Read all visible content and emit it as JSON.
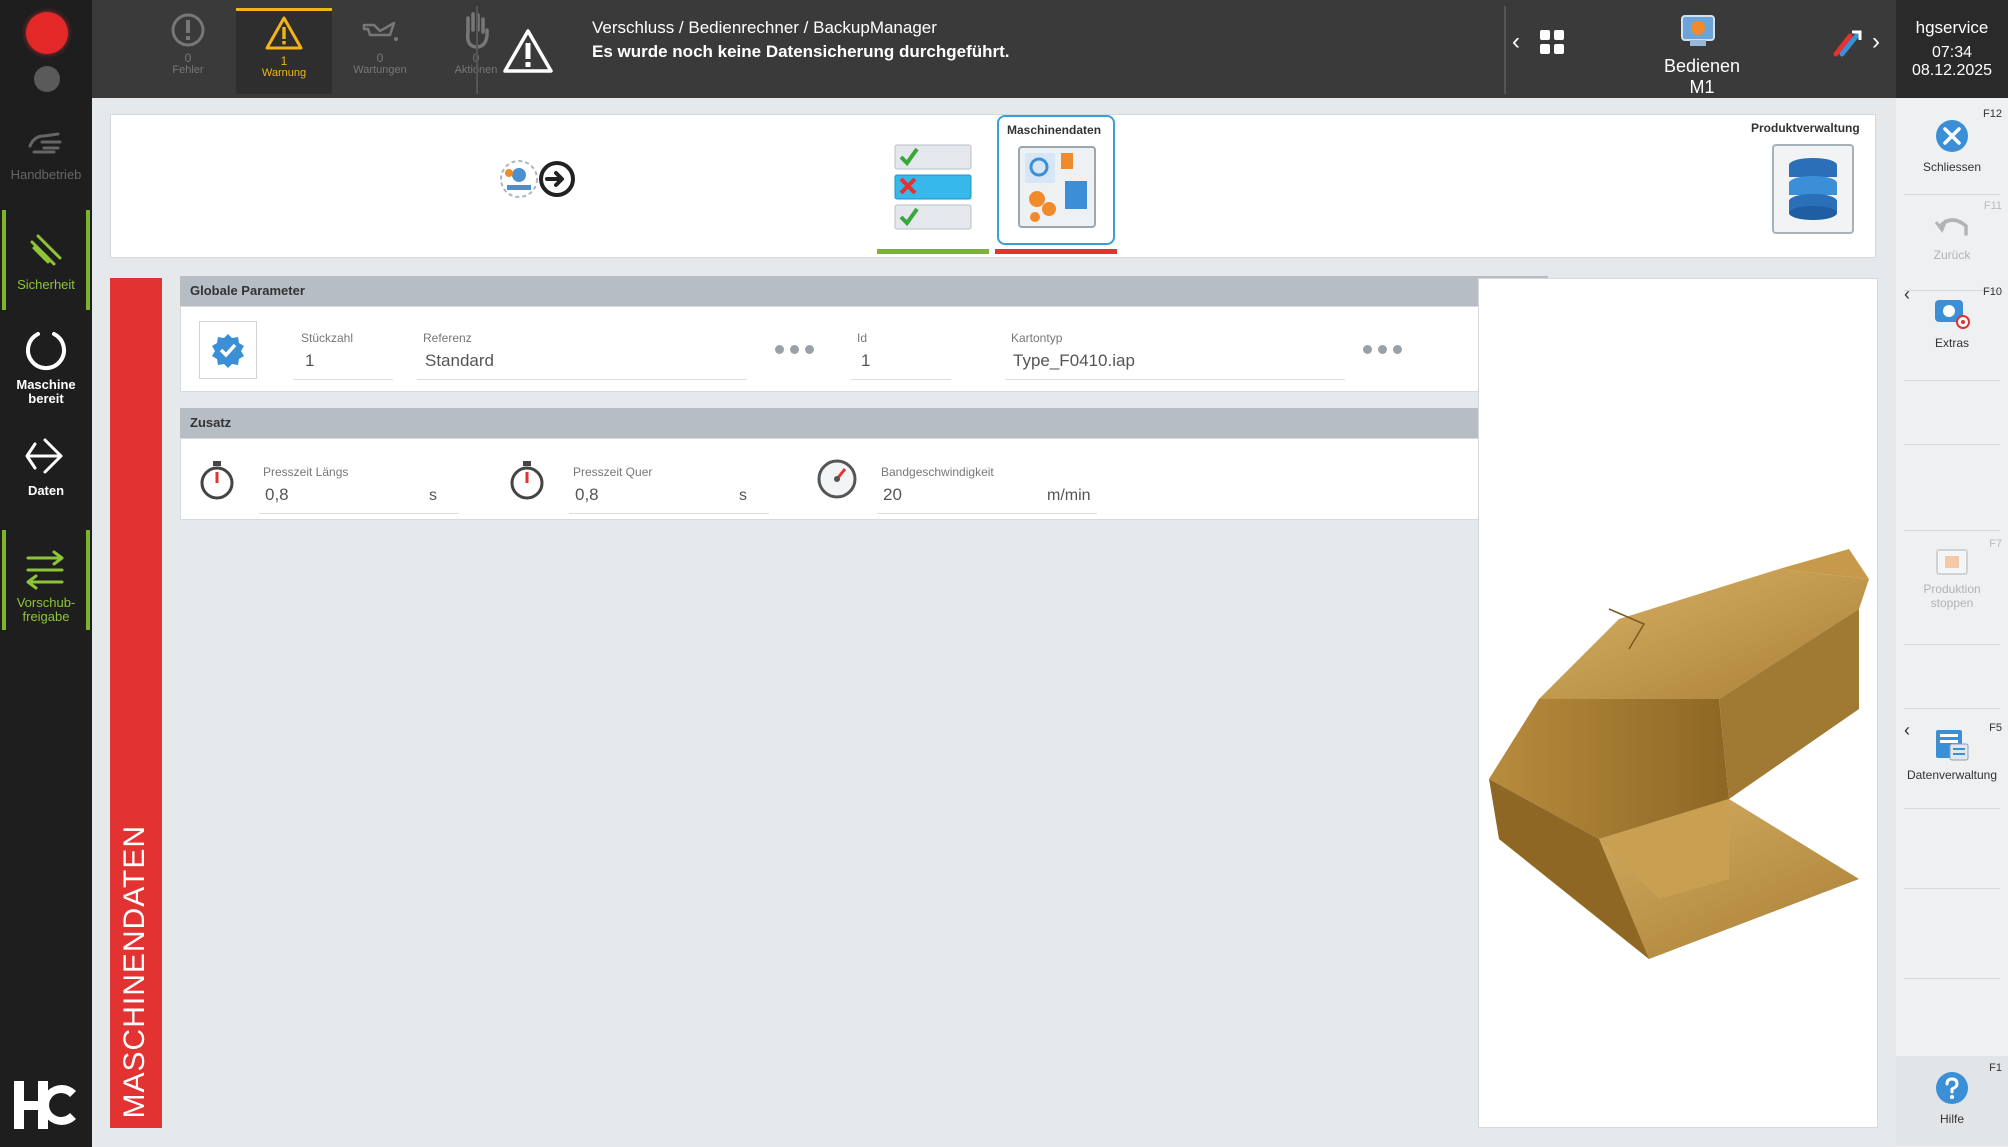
{
  "sidebar": {
    "items": [
      {
        "label": "Handbetrieb",
        "state": "disabled"
      },
      {
        "label": "Sicherheit",
        "state": "active"
      },
      {
        "label": "Maschine bereit",
        "state": "normal"
      },
      {
        "label": "Daten",
        "state": "normal"
      },
      {
        "label": "Vorschub-freigabe",
        "state": "active"
      }
    ],
    "logo": "HC"
  },
  "topbar": {
    "tabs": [
      {
        "count": "0",
        "label": "Fehler",
        "icon": "error-icon",
        "active": false
      },
      {
        "count": "1",
        "label": "Warnung",
        "icon": "warning-icon",
        "active": true
      },
      {
        "count": "0",
        "label": "Wartungen",
        "icon": "oilcan-icon",
        "active": false
      },
      {
        "count": "0",
        "label": "Aktionen",
        "icon": "hand-icon",
        "active": false
      }
    ],
    "message": {
      "title": "Verschluss / Bedienrechner / BackupManager",
      "text": "Es wurde noch keine Datensicherung durchgeführt."
    },
    "machine_label": "Bedienen M1",
    "user": "hgservice",
    "time": "07:34",
    "date": "08.12.2025"
  },
  "nav": {
    "machine_data_label": "Maschinendaten",
    "product_mgmt_label": "Produktverwaltung"
  },
  "side_title": "MASCHINENDATEN",
  "global_params": {
    "header": "Globale Parameter",
    "stueckzahl_label": "Stückzahl",
    "stueckzahl_value": "1",
    "referenz_label": "Referenz",
    "referenz_value": "Standard",
    "id_label": "Id",
    "id_value": "1",
    "kartontyp_label": "Kartontyp",
    "kartontyp_value": "Type_F0410.iap"
  },
  "zusatz": {
    "header": "Zusatz",
    "fields": [
      {
        "label": "Presszeit Längs",
        "value": "0,8",
        "unit": "s"
      },
      {
        "label": "Presszeit Quer",
        "value": "0,8",
        "unit": "s"
      },
      {
        "label": "Bandgeschwindigkeit",
        "value": "20",
        "unit": "m/min"
      }
    ]
  },
  "rightbar": {
    "buttons": [
      {
        "key": "F12",
        "label": "Schliessen",
        "disabled": false
      },
      {
        "key": "F11",
        "label": "Zurück",
        "disabled": true
      },
      {
        "key": "F10",
        "label": "Extras",
        "disabled": false
      },
      {
        "key": "F7",
        "label": "Produktion stoppen",
        "disabled": true
      },
      {
        "key": "F5",
        "label": "Datenverwaltung",
        "disabled": false
      },
      {
        "key": "F1",
        "label": "Hilfe",
        "disabled": false
      }
    ]
  },
  "colors": {
    "warning": "#f2b418",
    "accent_green": "#7cb52b",
    "accent_red": "#e23232",
    "accent_blue": "#3a8fd6"
  }
}
